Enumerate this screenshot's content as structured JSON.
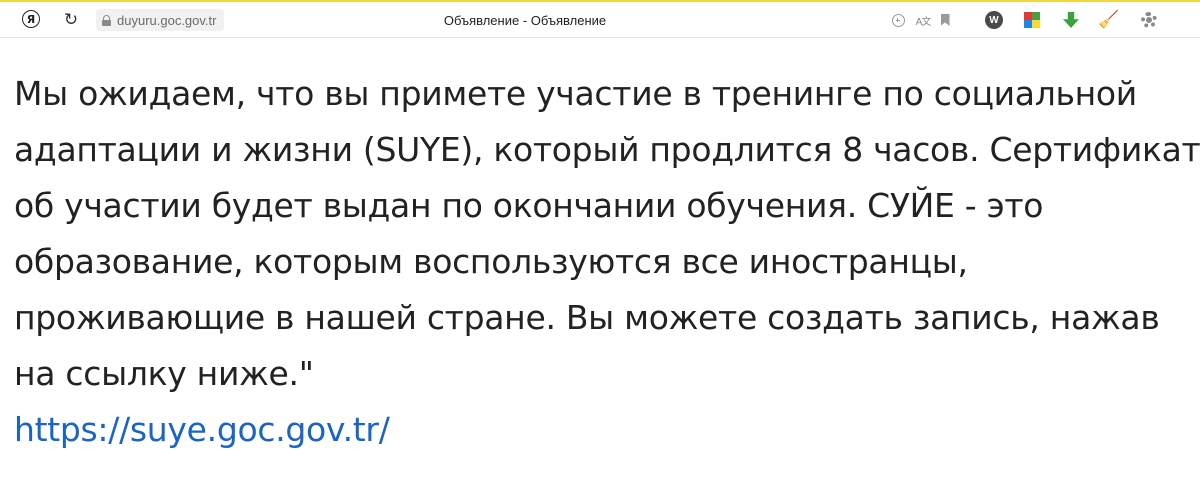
{
  "browser": {
    "logo_glyph": "Я",
    "reload_glyph": "↻",
    "url": "duyuru.goc.gov.tr",
    "page_title": "Объявление - Объявление",
    "translate_glyph": "A文",
    "extension_w_label": "W",
    "broom_glyph": "🧹"
  },
  "main": {
    "lines": [
      "Мы ожидаем, что вы примете участие в тренинге по социальной",
      "адаптации и жизни (SUYE), который продлится 8 часов. Сертификат",
      "об участии будет выдан по окончании обучения. СУЙЕ - это",
      "образование, которым воспользуются все иностранцы,",
      "проживающие в нашей стране. Вы можете создать запись, нажав",
      "на ссылку ниже.\""
    ],
    "link": "https://suye.goc.gov.tr/"
  },
  "colors": {
    "link": "#1a63c7",
    "toolbar_accent": "#f6d44a"
  }
}
